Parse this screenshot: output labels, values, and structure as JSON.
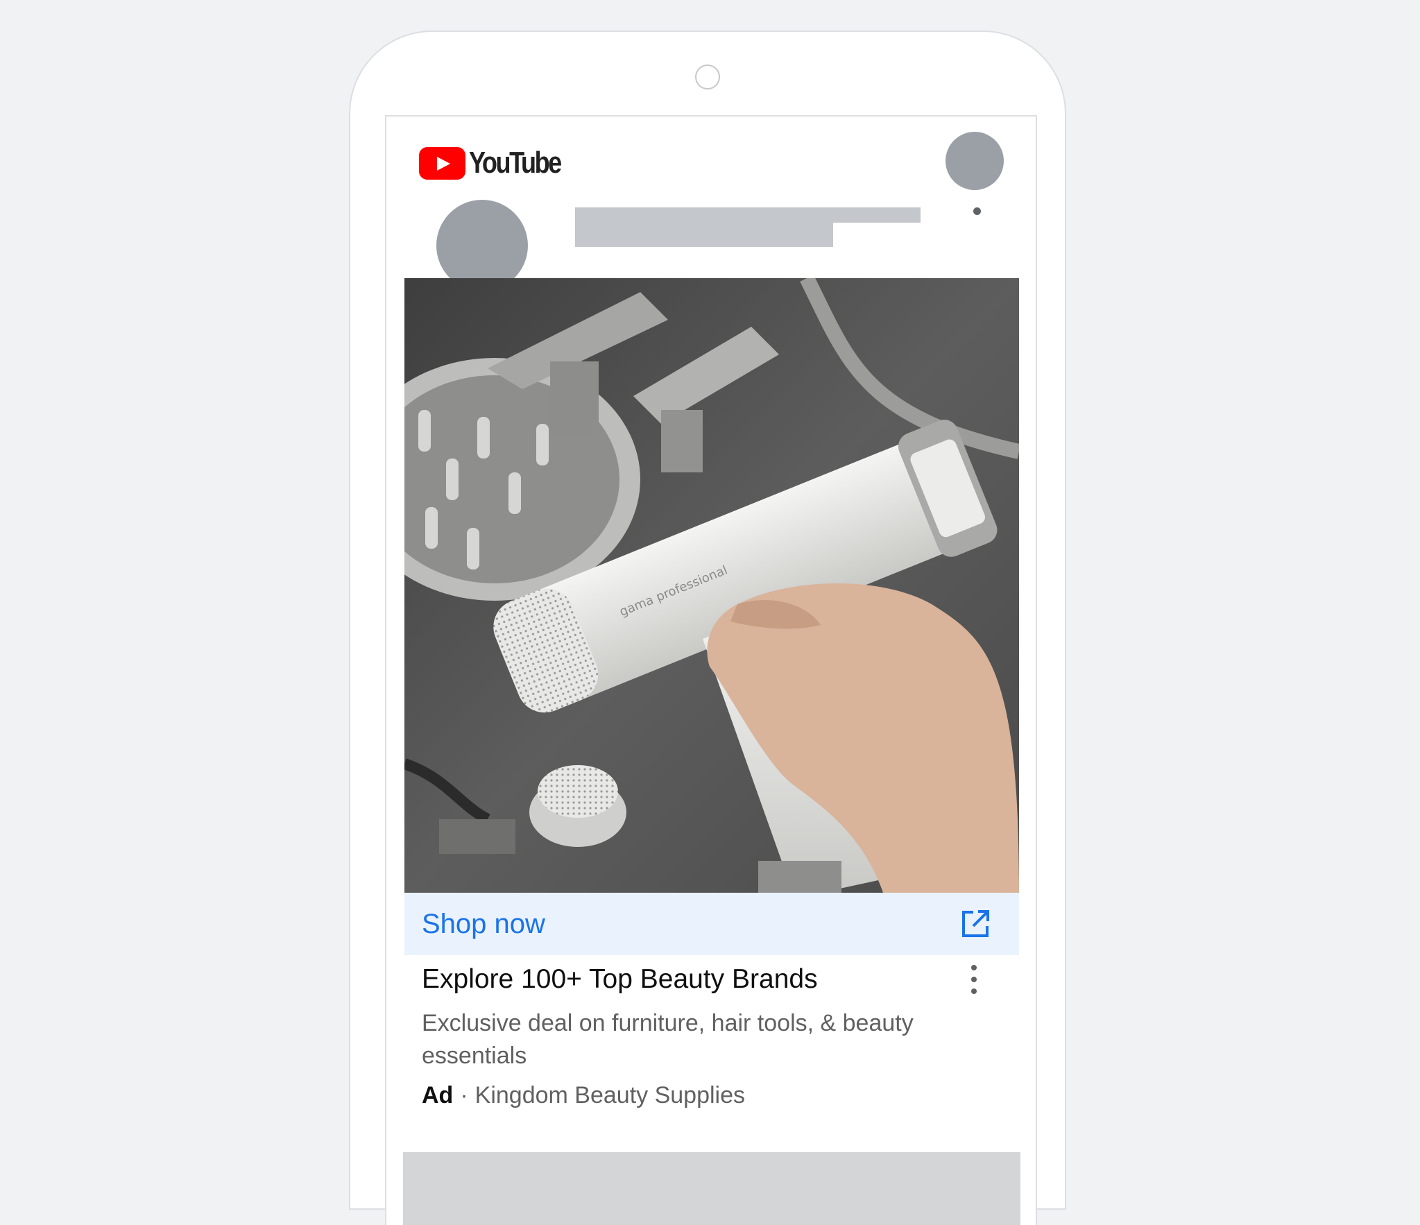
{
  "app": {
    "logo_text": "YouTube"
  },
  "ad": {
    "cta_label": "Shop now",
    "title": "Explore 100+ Top Beauty Brands",
    "description": "Exclusive deal on furniture, hair tools, & beauty essentials",
    "badge": "Ad",
    "separator": "·",
    "advertiser": "Kingdom Beauty Supplies",
    "image_subject": "hair dryer product photo",
    "image_brand_text": "gama professional"
  },
  "icons": {
    "logo": "youtube-play-icon",
    "cta": "open-in-new-icon",
    "menu": "more-vert-icon"
  },
  "colors": {
    "brand_red": "#ff0000",
    "link_blue": "#1a73e8",
    "cta_background": "#eaf3fd",
    "placeholder_gray": "#9aa0a6",
    "page_background": "#f1f2f4"
  }
}
